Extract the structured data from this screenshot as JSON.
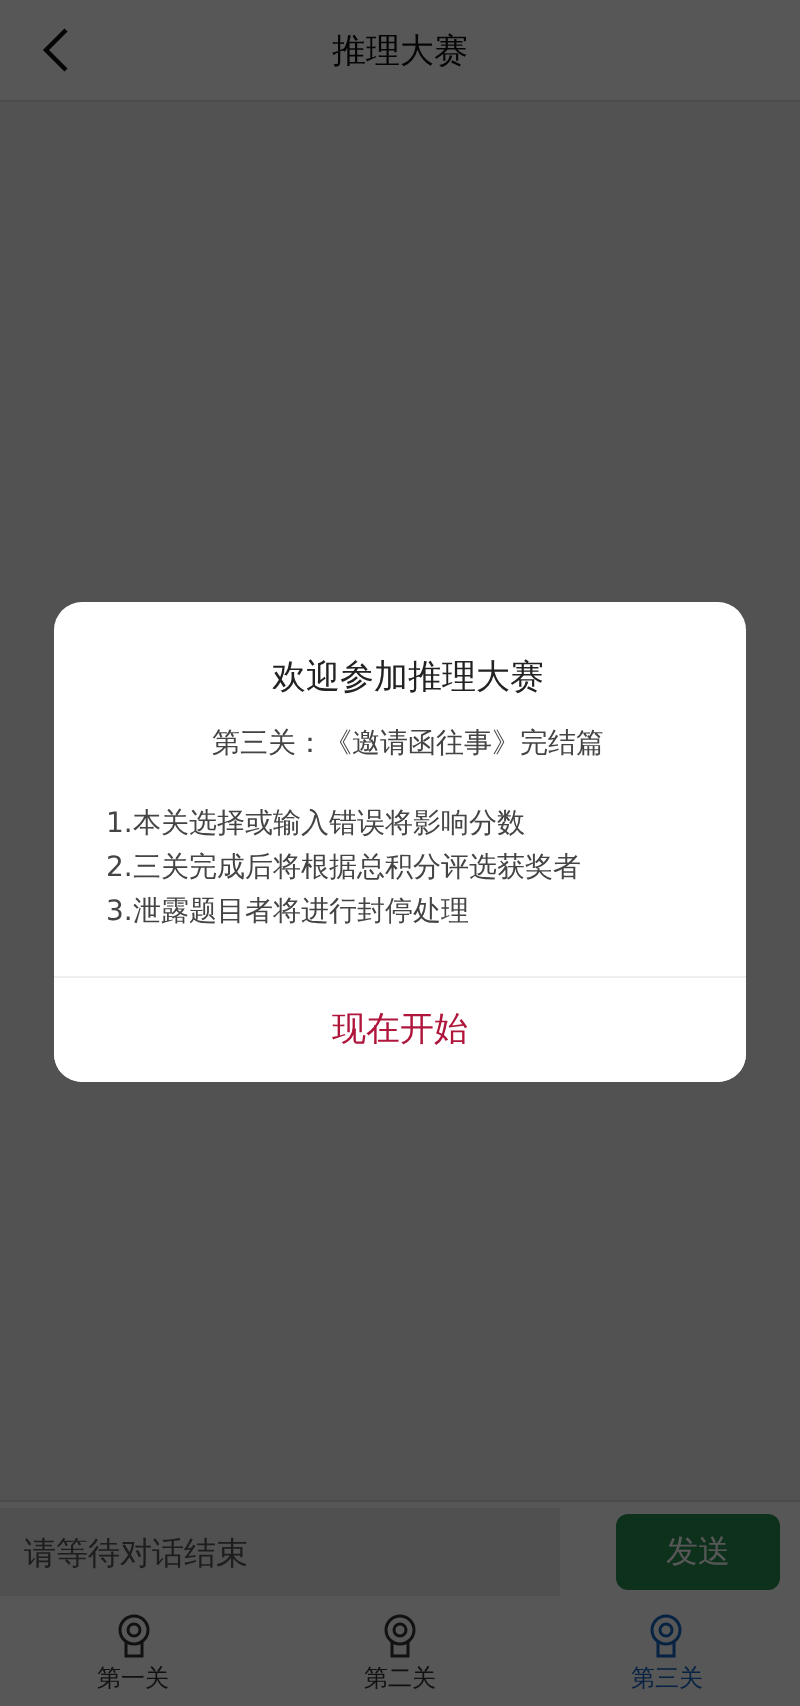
{
  "header": {
    "title": "推理大赛"
  },
  "input": {
    "placeholder": "请等待对话结束",
    "send": "发送"
  },
  "tabs": [
    {
      "label": "第一关",
      "selected": false
    },
    {
      "label": "第二关",
      "selected": false
    },
    {
      "label": "第三关",
      "selected": true
    }
  ],
  "dialog": {
    "title": "欢迎参加推理大赛",
    "subtitle": "第三关：《邀请函往事》完结篇",
    "rules": [
      "1.本关选择或输入错误将影响分数",
      "2.三关完成后将根据总积分评选获奖者",
      "3.泄露题目者将进行封停处理"
    ],
    "button": "现在开始"
  }
}
